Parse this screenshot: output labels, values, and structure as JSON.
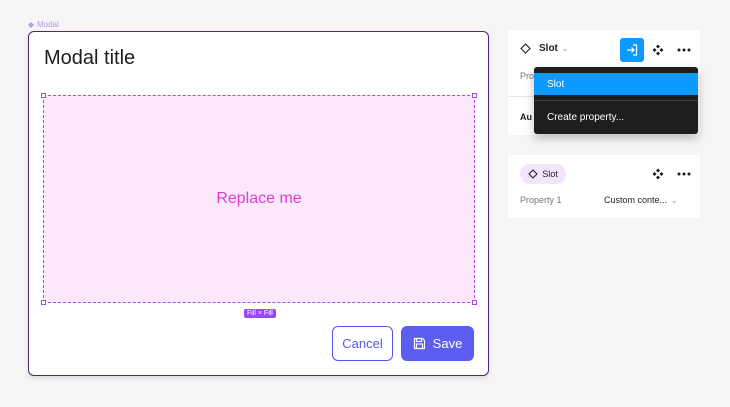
{
  "canvas": {
    "frame_label": "Modal"
  },
  "modal": {
    "title": "Modal title",
    "slot_text": "Replace me",
    "size_badge": "Fill × Fill",
    "cancel_label": "Cancel",
    "save_label": "Save"
  },
  "panel_top": {
    "component_name": "Slot",
    "partial_property_label": "Pro",
    "partial_section_label": "Au"
  },
  "dropdown": {
    "items": [
      "Slot",
      "Create property..."
    ],
    "selected": "Slot"
  },
  "panel_bottom": {
    "pill_label": "Slot",
    "property_label": "Property 1",
    "property_value": "Custom conte..."
  },
  "colors": {
    "accent_purple": "#5b5ef0",
    "selection_blue": "#0d99ff",
    "slot_fill": "#fce8fb",
    "slot_text": "#e33ad6"
  },
  "icons": {
    "component": "diamond-icon",
    "apply": "arrow-into-icon",
    "instance": "four-diamonds-icon",
    "more": "more-dots-icon",
    "save": "floppy-disk-icon"
  }
}
